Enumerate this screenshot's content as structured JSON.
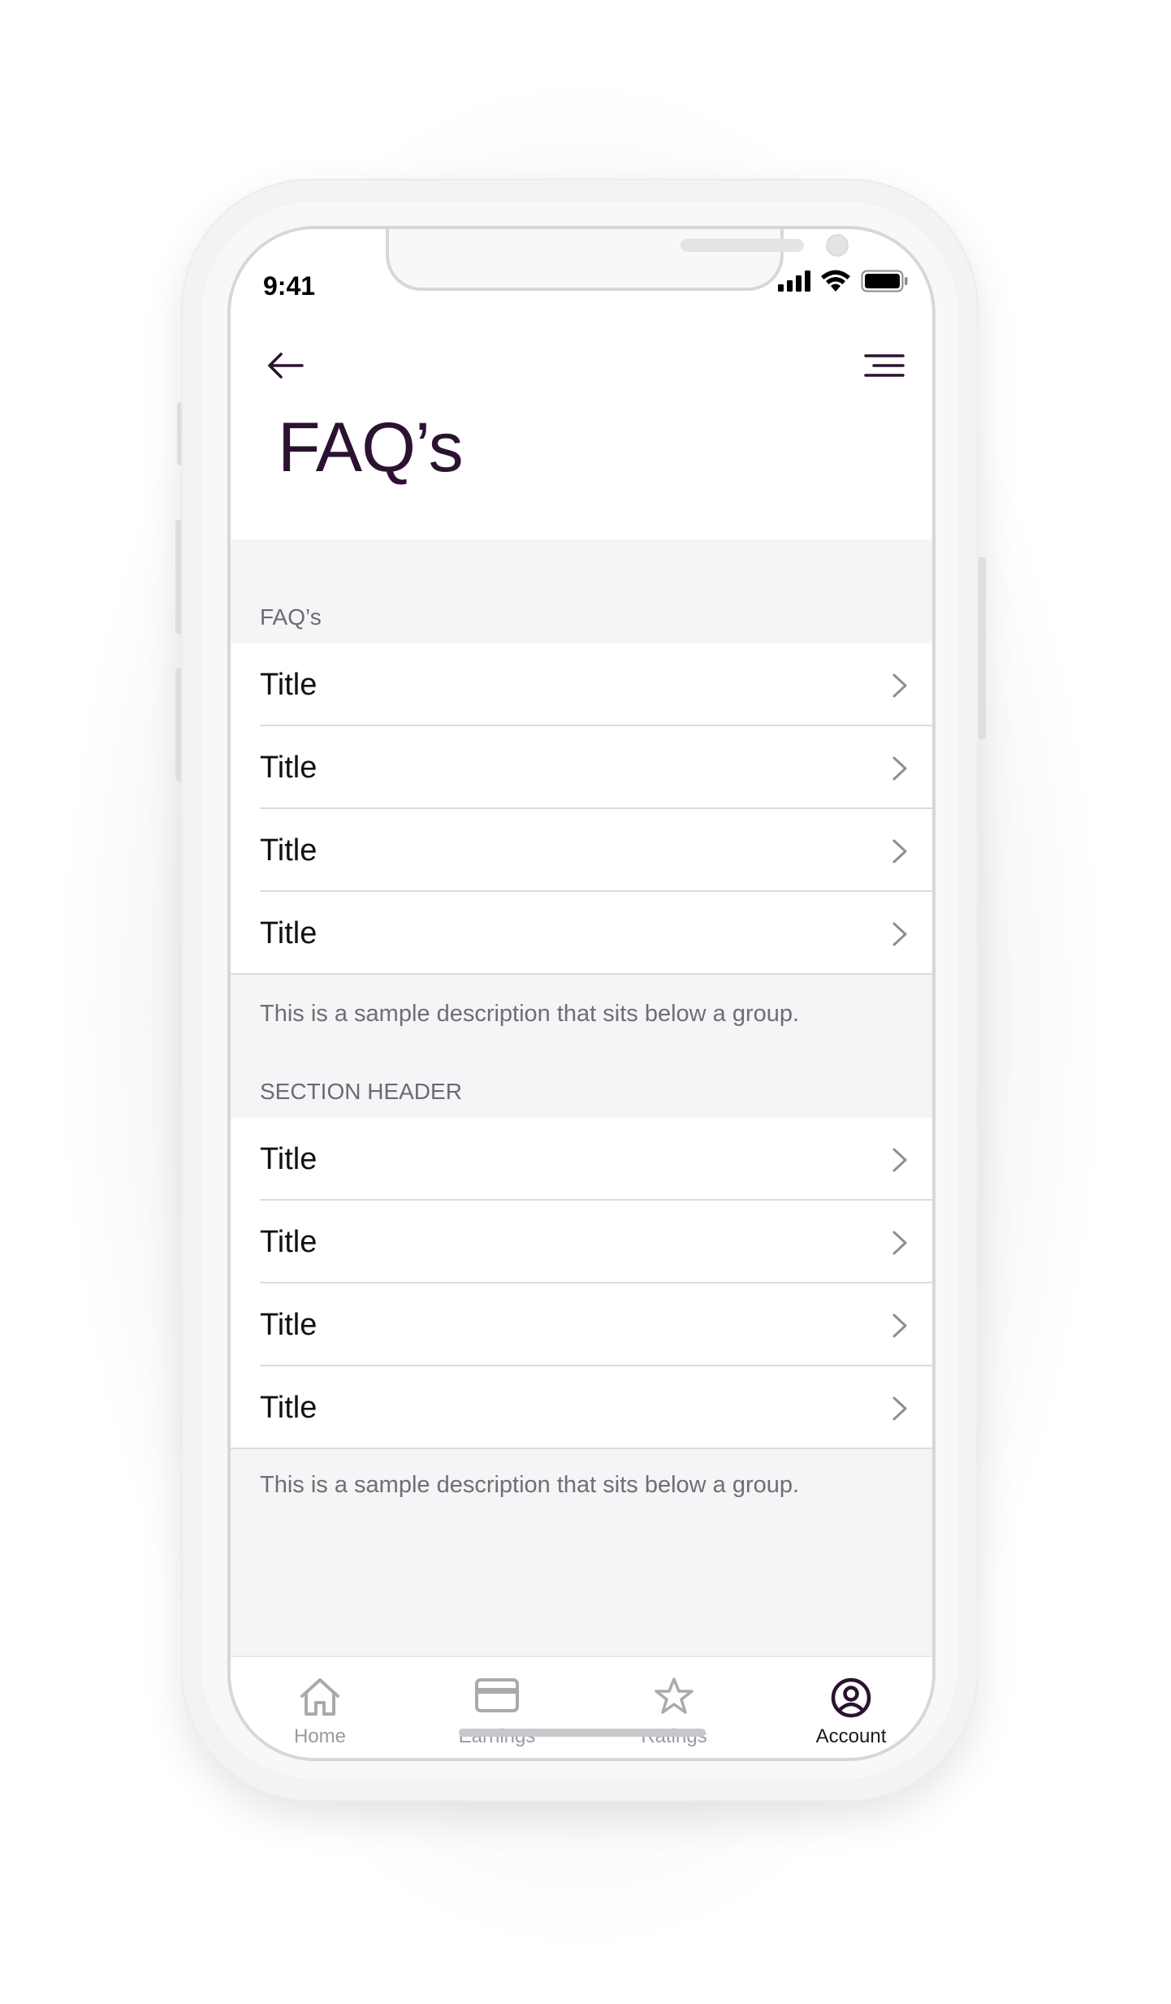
{
  "status_bar": {
    "time": "9:41"
  },
  "header": {
    "title": "FAQ’s"
  },
  "sections": [
    {
      "header": "FAQ’s",
      "items": [
        {
          "title": "Title"
        },
        {
          "title": "Title"
        },
        {
          "title": "Title"
        },
        {
          "title": "Title"
        }
      ],
      "description": "This is a sample description that sits below a group."
    },
    {
      "header": "SECTION HEADER",
      "items": [
        {
          "title": "Title"
        },
        {
          "title": "Title"
        },
        {
          "title": "Title"
        },
        {
          "title": "Title"
        }
      ],
      "description": "This is a sample description that sits below a group."
    }
  ],
  "tabbar": {
    "items": [
      {
        "label": "Home",
        "icon": "home-icon",
        "active": false
      },
      {
        "label": "Earnings",
        "icon": "card-icon",
        "active": false
      },
      {
        "label": "Ratings",
        "icon": "star-icon",
        "active": false
      },
      {
        "label": "Account",
        "icon": "account-icon",
        "active": true
      }
    ]
  },
  "colors": {
    "title": "#2c1231",
    "background": "#f5f5f7",
    "inactive_tab": "#9a9a9f",
    "active_tab": "#1a1a1c"
  }
}
